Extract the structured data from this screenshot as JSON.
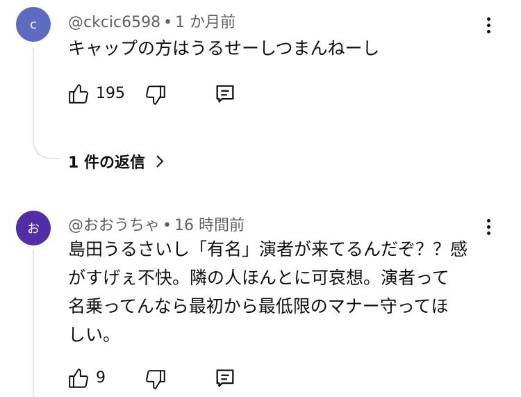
{
  "comments": [
    {
      "avatar_letter": "c",
      "avatar_color": "#5c6bc0",
      "handle": "@ckcic6598",
      "time": "1 か月前",
      "text": "キャップの方はうるせーしつまんねーし",
      "likes": "195",
      "replies_label": "1 件の返信"
    },
    {
      "avatar_letter": "お",
      "avatar_color": "#512da8",
      "handle": "@おおうちゃ",
      "time": "16 時間前",
      "text_lines": [
        "島田うるさいし「有名」演者が来てるんだぞ？？感",
        "がすげぇ不快。隣の人ほんとに可哀想。演者って",
        "名乗ってんなら最初から最低限のマナー守ってほ",
        "しい。"
      ],
      "likes": "9"
    }
  ],
  "meta_separator": "•",
  "icons": [
    "like-icon",
    "dislike-icon",
    "reply-icon",
    "more-vert-icon",
    "chevron-right-icon"
  ]
}
